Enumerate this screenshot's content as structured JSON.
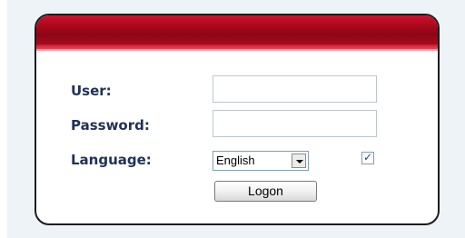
{
  "login": {
    "user_label": "User:",
    "password_label": "Password:",
    "language_label": "Language:",
    "user_value": "",
    "password_value": "",
    "language_selected": "English",
    "remember_checked": true,
    "logon_label": "Logon"
  },
  "colors": {
    "header_red": "#b00a1f",
    "label_navy": "#1f3158",
    "page_bg": "#eef3f8"
  },
  "icons": {
    "dropdown": "chevron-down-icon",
    "checkbox": "checkmark-icon"
  }
}
